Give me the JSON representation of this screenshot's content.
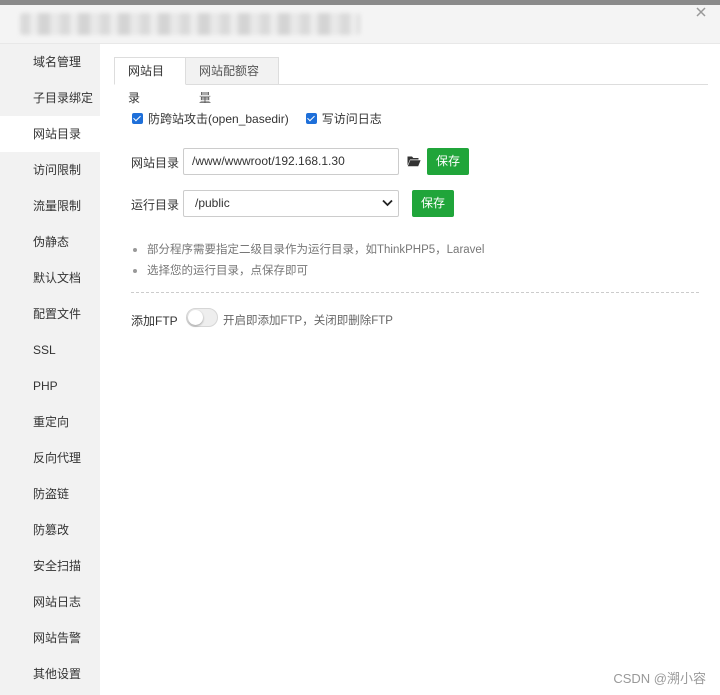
{
  "window": {
    "title_redacted": true
  },
  "sidebar": {
    "items": [
      {
        "label": "域名管理",
        "active": false
      },
      {
        "label": "子目录绑定",
        "active": false
      },
      {
        "label": "网站目录",
        "active": true
      },
      {
        "label": "访问限制",
        "active": false
      },
      {
        "label": "流量限制",
        "active": false
      },
      {
        "label": "伪静态",
        "active": false
      },
      {
        "label": "默认文档",
        "active": false
      },
      {
        "label": "配置文件",
        "active": false
      },
      {
        "label": "SSL",
        "active": false
      },
      {
        "label": "PHP",
        "active": false
      },
      {
        "label": "重定向",
        "active": false
      },
      {
        "label": "反向代理",
        "active": false
      },
      {
        "label": "防盗链",
        "active": false
      },
      {
        "label": "防篡改",
        "active": false
      },
      {
        "label": "安全扫描",
        "active": false
      },
      {
        "label": "网站日志",
        "active": false
      },
      {
        "label": "网站告警",
        "active": false
      },
      {
        "label": "其他设置",
        "active": false
      }
    ]
  },
  "tabs": [
    {
      "label": "网站目录",
      "active": true
    },
    {
      "label": "网站配额容量",
      "active": false
    }
  ],
  "options": {
    "anti_xss": {
      "label": "防跨站攻击(open_basedir)",
      "checked": true
    },
    "access_log": {
      "label": "写访问日志",
      "checked": true
    }
  },
  "site_dir": {
    "label": "网站目录",
    "value": "/www/wwwroot/192.168.1.30",
    "save_label": "保存"
  },
  "run_dir": {
    "label": "运行目录",
    "value": "/public",
    "save_label": "保存"
  },
  "tips": [
    "部分程序需要指定二级目录作为运行目录，如ThinkPHP5，Laravel",
    "选择您的运行目录，点保存即可"
  ],
  "ftp": {
    "label": "添加FTP",
    "enabled": false,
    "description": "开启即添加FTP，关闭即删除FTP"
  },
  "watermark": "CSDN @溯小容",
  "colors": {
    "accent_green": "#20a53a",
    "checkbox_blue": "#1e6fd9",
    "sidebar_bg": "#f2f2f2"
  },
  "icons": [
    "close-icon",
    "folder-open-icon",
    "chevron-down-icon"
  ]
}
